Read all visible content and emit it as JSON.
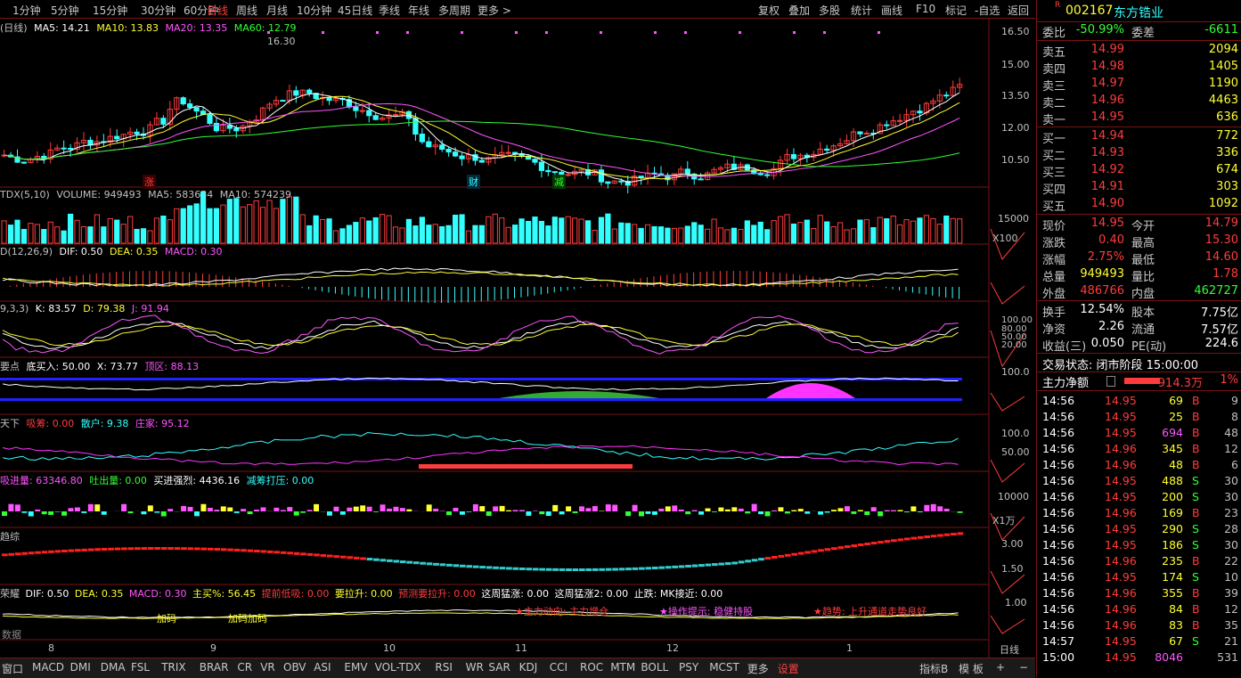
{
  "periods": [
    "1分钟",
    "5分钟",
    "15分钟",
    "30分钟",
    "60分钟",
    "日线",
    "周线",
    "月线",
    "10分钟",
    "45日线",
    "季线",
    "年线",
    "多周期",
    "更多 >"
  ],
  "active_period": "日线",
  "toolbar": [
    "复权",
    "叠加",
    "多股",
    "统计",
    "画线",
    "F10",
    "标记",
    "-自选",
    "返回"
  ],
  "main_panel": {
    "label": "(日线)",
    "ma5": "MA5: 14.21",
    "ma10": "MA10: 13.83",
    "ma20": "MA20: 13.35",
    "ma60": "MA60: 12.79",
    "high_mark": "16.30",
    "price_axis": [
      "16.50",
      "15.00",
      "13.50",
      "12.00",
      "10.50"
    ],
    "events": [
      "涨",
      "财",
      "减"
    ]
  },
  "volume_panel": {
    "label": "TDX(5,10)",
    "volume": "VOLUME: 949493",
    "ma5": "MA5: 583634",
    "ma10": "MA10: 574239",
    "axis": [
      "15000",
      "X100"
    ]
  },
  "macd_panel": {
    "label": "D(12,26,9)",
    "dif": "DIF: 0.50",
    "dea": "DEA: 0.35",
    "macd": "MACD: 0.30"
  },
  "kdj_panel": {
    "label": "9,3,3)",
    "k": "K: 83.57",
    "d": "D: 79.38",
    "j": "J: 91.94",
    "axis": [
      "100.00",
      "80.00",
      "50.00",
      "20.00"
    ]
  },
  "point_panel": {
    "label": "要点",
    "buy": "底买入: 50.00",
    "x": "X: 73.77",
    "top": "顶区: 88.13",
    "axis": [
      "100.0"
    ]
  },
  "world_panel": {
    "label": "天下",
    "absorb": "吸筹: 0.00",
    "retail": "散户: 9.38",
    "banker": "庄家: 95.12",
    "axis": [
      "100.0",
      "50.00"
    ]
  },
  "flow_panel": {
    "label": "吸进量: 63346.80",
    "out": "吐出量: 0.00",
    "strong": "买进强烈: 4436.16",
    "press": "减筹打压: 0.00",
    "axis": [
      "10000",
      "X1万"
    ]
  },
  "trend_panel": {
    "label": "趋综",
    "axis": [
      "3.00",
      "1.50"
    ]
  },
  "signal_panel": {
    "label": "荣耀",
    "dif": "DIF: 0.50",
    "dea": "DEA: 0.35",
    "macd": "MACD: 0.30",
    "buy_pct": "主买%: 56.45",
    "low_absorb": "提前低吸: 0.00",
    "rise": "要拉升: 0.00",
    "pre_rise": "预测要拉升: 0.00",
    "week_up": "这周猛涨: 0.00",
    "week_up2": "这周猛涨2: 0.00",
    "stop": "止跌: MK接近: 0.00",
    "notes": [
      "★主力动向: 主力增仓",
      "★操作提示: 稳健持股",
      "★趋势: 上升通道走势良好"
    ],
    "tags": [
      "加码",
      "加码加码"
    ],
    "axis": [
      "1.00"
    ],
    "data_label": "数据"
  },
  "months": [
    "8",
    "9",
    "10",
    "11",
    "12",
    "1"
  ],
  "period_label": "日线",
  "tabs": [
    "窗口",
    "MACD",
    "DMI",
    "DMA",
    "FSL",
    "TRIX",
    "BRAR",
    "CR",
    "VR",
    "OBV",
    "ASI",
    "EMV",
    "VOL-TDX",
    "RSI",
    "WR",
    "SAR",
    "KDJ",
    "CCI",
    "ROC",
    "MTM",
    "BOLL",
    "PSY",
    "MCST",
    "更多",
    "设置"
  ],
  "tabs_right": [
    "指标B",
    "模 板",
    "+",
    "−"
  ],
  "stock": {
    "badge": "R",
    "code": "002167",
    "name": "东方锆业"
  },
  "ratio": {
    "label": "委比",
    "value": "-50.99%",
    "diff_label": "委差",
    "diff": "-6611"
  },
  "asks": [
    {
      "label": "卖五",
      "price": "14.99",
      "vol": "2094"
    },
    {
      "label": "卖四",
      "price": "14.98",
      "vol": "1405"
    },
    {
      "label": "卖三",
      "price": "14.97",
      "vol": "1190"
    },
    {
      "label": "卖二",
      "price": "14.96",
      "vol": "4463"
    },
    {
      "label": "卖一",
      "price": "14.95",
      "vol": "636"
    }
  ],
  "bids": [
    {
      "label": "买一",
      "price": "14.94",
      "vol": "772"
    },
    {
      "label": "买二",
      "price": "14.93",
      "vol": "336"
    },
    {
      "label": "买三",
      "price": "14.92",
      "vol": "674"
    },
    {
      "label": "买四",
      "price": "14.91",
      "vol": "303"
    },
    {
      "label": "买五",
      "price": "14.90",
      "vol": "1092"
    }
  ],
  "quote": [
    {
      "l1": "现价",
      "v1": "14.95",
      "c1": "red",
      "l2": "今开",
      "v2": "14.79",
      "c2": "red"
    },
    {
      "l1": "涨跌",
      "v1": "0.40",
      "c1": "red",
      "l2": "最高",
      "v2": "15.30",
      "c2": "red"
    },
    {
      "l1": "涨幅",
      "v1": "2.75%",
      "c1": "red",
      "l2": "最低",
      "v2": "14.60",
      "c2": "red"
    },
    {
      "l1": "总量",
      "v1": "949493",
      "c1": "yel",
      "l2": "量比",
      "v2": "1.78",
      "c2": "red"
    },
    {
      "l1": "外盘",
      "v1": "486766",
      "c1": "red",
      "l2": "内盘",
      "v2": "462727",
      "c2": "grn"
    }
  ],
  "quote2": [
    {
      "l1": "换手",
      "v1": "12.54%",
      "l2": "股本",
      "v2": "7.75亿"
    },
    {
      "l1": "净资",
      "v1": "2.26",
      "l2": "流通",
      "v2": "7.57亿"
    },
    {
      "l1": "收益(三)",
      "v1": "0.050",
      "l2": "PE(动)",
      "v2": "224.6"
    }
  ],
  "trade_status": "交易状态: 闭市阶段 15:00:00",
  "main_net": {
    "label": "主力净额",
    "value": "914.3万",
    "pct": "1%"
  },
  "ticks": [
    {
      "t": "14:56",
      "p": "14.95",
      "v": "69",
      "s": "B",
      "n": "9",
      "vc": "yel"
    },
    {
      "t": "14:56",
      "p": "14.95",
      "v": "25",
      "s": "B",
      "n": "8",
      "vc": "yel"
    },
    {
      "t": "14:56",
      "p": "14.95",
      "v": "694",
      "s": "B",
      "n": "48",
      "vc": "mag"
    },
    {
      "t": "14:56",
      "p": "14.96",
      "v": "345",
      "s": "B",
      "n": "12",
      "vc": "yel"
    },
    {
      "t": "14:56",
      "p": "14.96",
      "v": "48",
      "s": "B",
      "n": "6",
      "vc": "yel"
    },
    {
      "t": "14:56",
      "p": "14.95",
      "v": "488",
      "s": "S",
      "n": "30",
      "vc": "yel"
    },
    {
      "t": "14:56",
      "p": "14.95",
      "v": "200",
      "s": "S",
      "n": "30",
      "vc": "yel"
    },
    {
      "t": "14:56",
      "p": "14.96",
      "v": "169",
      "s": "B",
      "n": "23",
      "vc": "yel"
    },
    {
      "t": "14:56",
      "p": "14.95",
      "v": "290",
      "s": "S",
      "n": "28",
      "vc": "yel"
    },
    {
      "t": "14:56",
      "p": "14.95",
      "v": "186",
      "s": "S",
      "n": "30",
      "vc": "yel"
    },
    {
      "t": "14:56",
      "p": "14.96",
      "v": "235",
      "s": "B",
      "n": "22",
      "vc": "yel"
    },
    {
      "t": "14:56",
      "p": "14.95",
      "v": "174",
      "s": "S",
      "n": "10",
      "vc": "yel"
    },
    {
      "t": "14:56",
      "p": "14.96",
      "v": "355",
      "s": "B",
      "n": "39",
      "vc": "yel"
    },
    {
      "t": "14:56",
      "p": "14.96",
      "v": "84",
      "s": "B",
      "n": "12",
      "vc": "yel"
    },
    {
      "t": "14:56",
      "p": "14.96",
      "v": "83",
      "s": "B",
      "n": "35",
      "vc": "yel"
    },
    {
      "t": "14:57",
      "p": "14.95",
      "v": "67",
      "s": "S",
      "n": "21",
      "vc": "yel"
    },
    {
      "t": "15:00",
      "p": "14.95",
      "v": "8046",
      "s": "",
      "n": "531",
      "vc": "mag"
    }
  ],
  "colors": {
    "up": "#ff3c3c",
    "down": "#33ffff",
    "ma5": "#ffffff",
    "ma10": "#ffff33",
    "ma20": "#ff55ff",
    "ma60": "#33ff33",
    "border": "#7a1212"
  }
}
